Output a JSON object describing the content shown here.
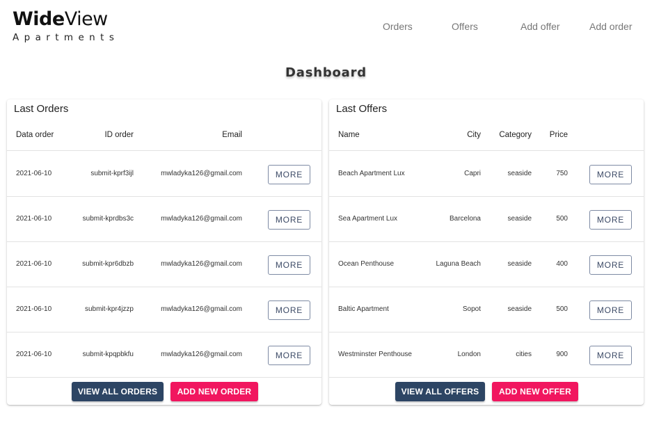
{
  "brand": {
    "wide": "Wide",
    "view": "View",
    "sub": "Apartments"
  },
  "nav": {
    "orders": "Orders",
    "offers": "Offers",
    "add_offer": "Add offer",
    "add_order": "Add order"
  },
  "page_title": "Dashboard",
  "orders": {
    "title": "Last Orders",
    "columns": [
      "Data order",
      "ID order",
      "Email"
    ],
    "rows": [
      {
        "date": "2021-06-10",
        "id": "submit-kprf3ijl",
        "email": "mwladyka126@gmail.com",
        "action": "MORE"
      },
      {
        "date": "2021-06-10",
        "id": "submit-kprdbs3c",
        "email": "mwladyka126@gmail.com",
        "action": "MORE"
      },
      {
        "date": "2021-06-10",
        "id": "submit-kpr6dbzb",
        "email": "mwladyka126@gmail.com",
        "action": "MORE"
      },
      {
        "date": "2021-06-10",
        "id": "submit-kpr4jzzp",
        "email": "mwladyka126@gmail.com",
        "action": "MORE"
      },
      {
        "date": "2021-06-10",
        "id": "submit-kpqpbkfu",
        "email": "mwladyka126@gmail.com",
        "action": "MORE"
      }
    ],
    "view_all": "VIEW ALL ORDERS",
    "add_new": "ADD NEW ORDER"
  },
  "offers": {
    "title": "Last Offers",
    "columns": [
      "Name",
      "City",
      "Category",
      "Price"
    ],
    "rows": [
      {
        "name": "Beach Apartment Lux",
        "city": "Capri",
        "category": "seaside",
        "price": "750",
        "action": "MORE"
      },
      {
        "name": "Sea Apartment Lux",
        "city": "Barcelona",
        "category": "seaside",
        "price": "500",
        "action": "MORE"
      },
      {
        "name": "Ocean Penthouse",
        "city": "Laguna Beach",
        "category": "seaside",
        "price": "400",
        "action": "MORE"
      },
      {
        "name": "Baltic Apartment",
        "city": "Sopot",
        "category": "seaside",
        "price": "500",
        "action": "MORE"
      },
      {
        "name": "Westminster Penthouse",
        "city": "London",
        "category": "cities",
        "price": "900",
        "action": "MORE"
      }
    ],
    "view_all": "VIEW ALL OFFERS",
    "add_new": "ADD NEW OFFER"
  },
  "colors": {
    "navy": "#2d4564",
    "pink": "#f1165f",
    "nav_text": "#777777"
  }
}
